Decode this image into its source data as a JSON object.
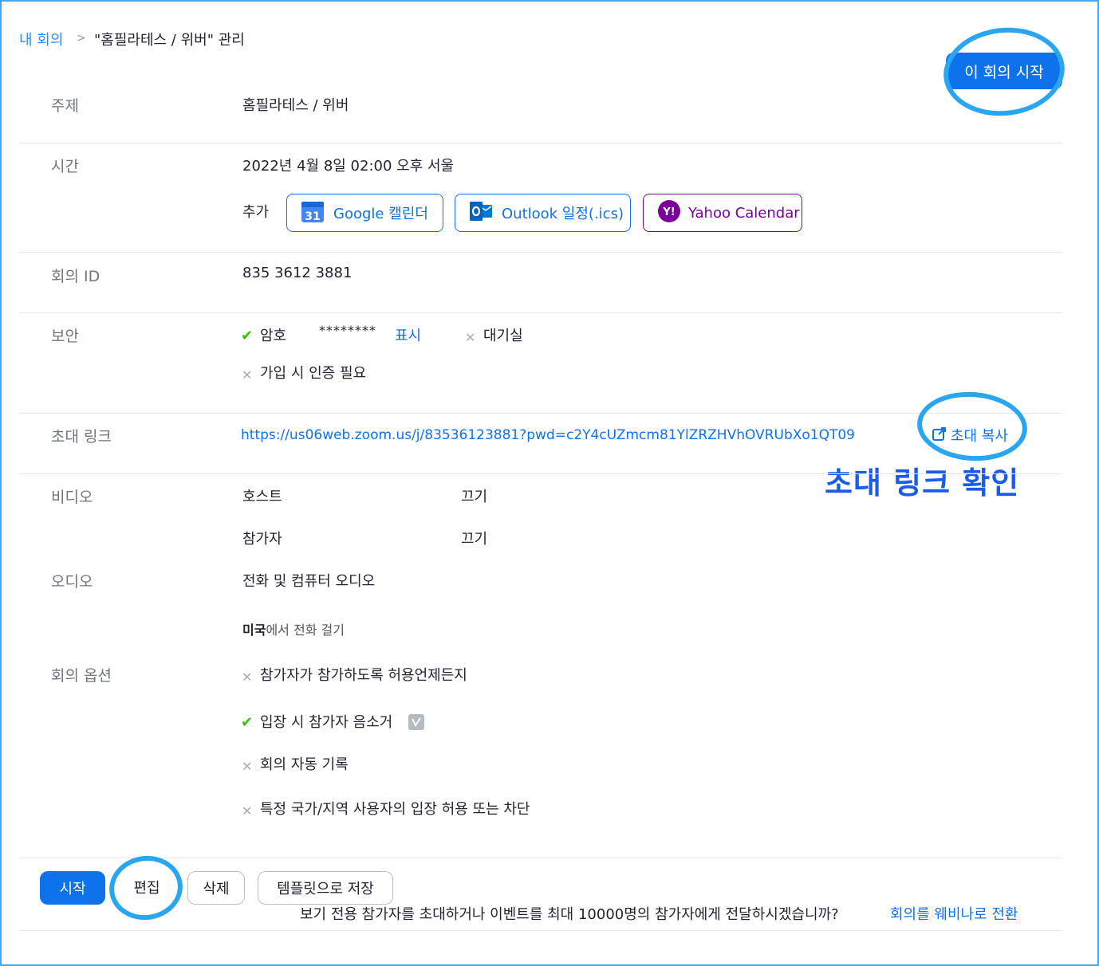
{
  "breadcrumb": {
    "parent": "내 회의",
    "separator": ">",
    "current": "\"홈필라테스 / 위버\" 관리"
  },
  "header": {
    "start_meeting_button": "이 회의 시작"
  },
  "topic": {
    "label": "주제",
    "value": "홈필라테스 / 위버"
  },
  "time": {
    "label": "시간",
    "value": "2022년 4월 8일 02:00 오후 서울",
    "add_label": "추가",
    "calendars": [
      {
        "label": "Google 캘린더",
        "icon": "google-calendar-icon",
        "color": "#0e72ed"
      },
      {
        "label": "Outlook 일정(.ics)",
        "icon": "outlook-icon",
        "color": "#0e72ed"
      },
      {
        "label": "Yahoo Calendar",
        "icon": "yahoo-icon",
        "color": "#7b0099"
      }
    ]
  },
  "meeting_id": {
    "label": "회의 ID",
    "value": "835 3612 3881"
  },
  "security": {
    "label": "보안",
    "passcode_label": "암호",
    "passcode_value": "********",
    "show_link": "표시",
    "waiting_room": "대기실",
    "auth_required": "가입 시 인증 필요"
  },
  "invite": {
    "label": "초대 링크",
    "url": "https://us06web.zoom.us/j/83536123881?pwd=c2Y4cUZmcm81YlZRZHVhOVRUbXo1QT09",
    "copy_label": "초대 복사",
    "annotation": "초대 링크 확인"
  },
  "video": {
    "label": "비디오",
    "host_label": "호스트",
    "host_value": "끄기",
    "participant_label": "참가자",
    "participant_value": "끄기"
  },
  "audio": {
    "label": "오디오",
    "value": "전화 및 컴퓨터 오디오",
    "dial_country": "미국",
    "dial_suffix": "에서 전화 걸기"
  },
  "options": {
    "label": "회의 옵션",
    "items": [
      {
        "text": "참가자가 참가하도록 허용언제든지",
        "enabled": false
      },
      {
        "text": "입장 시 참가자 음소거",
        "enabled": true
      },
      {
        "text": "회의 자동 기록",
        "enabled": false
      },
      {
        "text": "특정 국가/지역 사용자의 입장 허용 또는 차단",
        "enabled": false
      }
    ]
  },
  "footer": {
    "start": "시작",
    "edit": "편집",
    "delete": "삭제",
    "save_template": "템플릿으로 저장",
    "webinar_prompt": "보기 전용 참가자를 초대하거나 이벤트를 최대 10000명의 참가자에게 전달하시겠습니까?",
    "webinar_link": "회의를 웨비나로 전환"
  },
  "colors": {
    "accent": "#0e72ed",
    "annotation": "#2aa6f0",
    "check": "#32c100"
  }
}
